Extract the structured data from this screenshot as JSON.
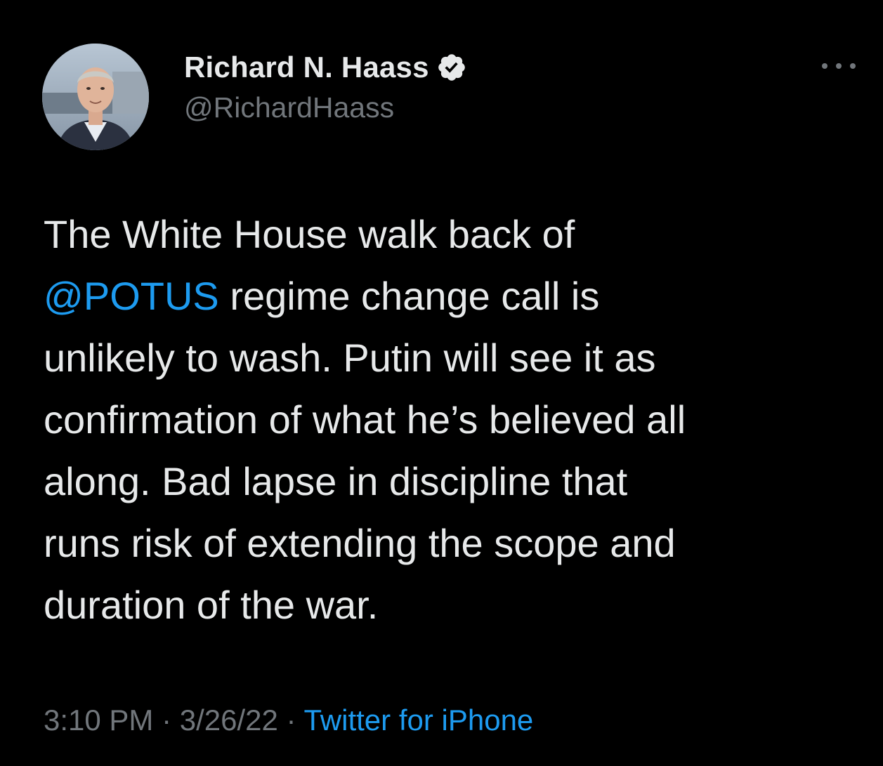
{
  "author": {
    "display_name": "Richard N. Haass",
    "handle": "@RichardHaass",
    "verified": true
  },
  "tweet": {
    "lines": [
      {
        "pre": "The White House walk back of",
        "mention": "",
        "post": ""
      },
      {
        "pre": "",
        "mention": "@POTUS",
        "post": " regime change call is"
      },
      {
        "pre": "unlikely to wash. Putin will see it as",
        "mention": "",
        "post": ""
      },
      {
        "pre": "confirmation of what he’s believed all",
        "mention": "",
        "post": ""
      },
      {
        "pre": "along. Bad lapse in discipline that",
        "mention": "",
        "post": ""
      },
      {
        "pre": "runs risk of extending the scope and",
        "mention": "",
        "post": ""
      },
      {
        "pre": "duration of the war.",
        "mention": "",
        "post": ""
      }
    ]
  },
  "meta": {
    "time": "3:10 PM",
    "separator": " · ",
    "date": "3/26/22",
    "source": "Twitter for iPhone"
  },
  "icons": {
    "verified": "verified-badge-icon",
    "more": "more-options-icon"
  },
  "colors": {
    "background": "#000000",
    "text": "#e7e9ea",
    "secondary": "#71767b",
    "accent": "#1d9bf0"
  }
}
